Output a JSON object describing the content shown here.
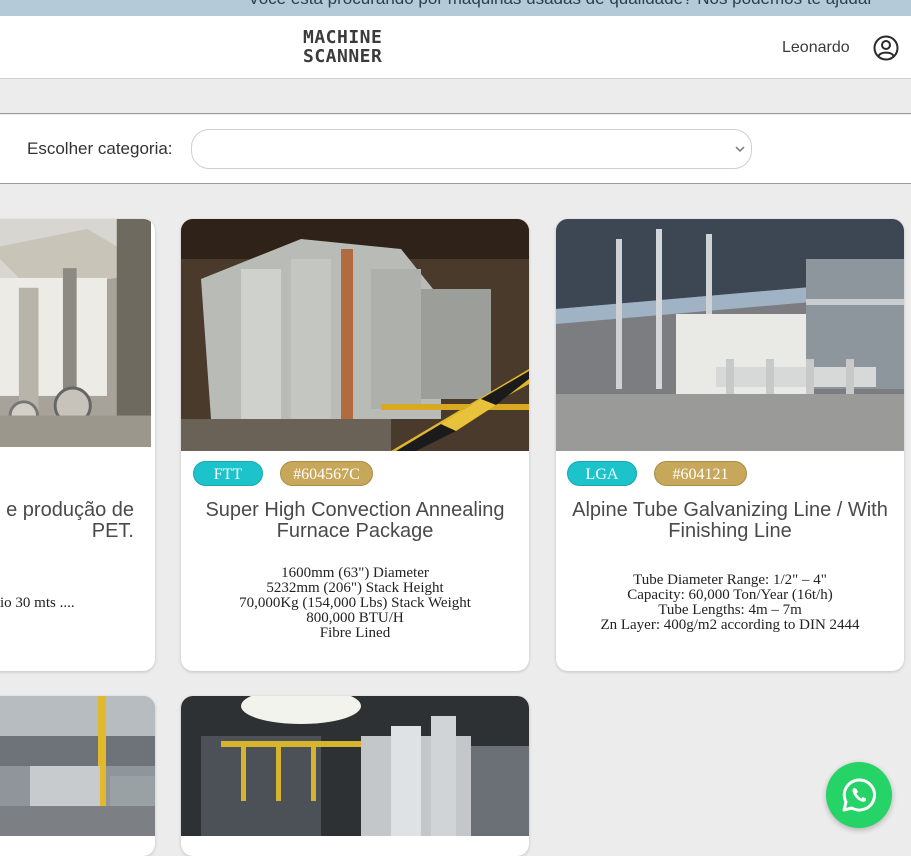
{
  "topbar": {
    "text": "Você está procurando por máquinas usadas de qualidade? Nós podemos te ajudar"
  },
  "header": {
    "logo_line1": "MACHINE",
    "logo_line2": "SCANNER",
    "user_name": "Leonardo",
    "user_icon": "user-circle-icon"
  },
  "filter": {
    "label": "Escolher categoria:",
    "selected": ""
  },
  "cards": [
    {
      "title": "e produção de PET.",
      "title_line1": "e produção de",
      "title_line2": "PET.",
      "desc": [
        "io 30 mts ...."
      ]
    },
    {
      "code": "FTT",
      "ref": "#604567C",
      "title_line1": "Super High Convection Annealing",
      "title_line2": "Furnace Package",
      "desc": [
        "1600mm (63\") Diameter",
        "5232mm (206\") Stack Height",
        "70,000Kg (154,000 Lbs) Stack Weight",
        "800,000 BTU/H",
        "Fibre Lined"
      ]
    },
    {
      "code": "LGA",
      "ref": "#604121",
      "title_line1": "Alpine Tube Galvanizing Line / With",
      "title_line2": "Finishing Line",
      "desc": [
        "Tube Diameter Range:  1/2\" – 4\"",
        "Capacity:  60,000 Ton/Year (16t/h)",
        "Tube Lengths:  4m – 7m",
        "Zn Layer:  400g/m2 according to DIN 2444"
      ]
    }
  ],
  "whatsapp": {
    "icon": "whatsapp-icon"
  },
  "colors": {
    "code_badge": "#1cc3cb",
    "ref_badge": "#c7a75a",
    "whatsapp": "#25d366"
  }
}
